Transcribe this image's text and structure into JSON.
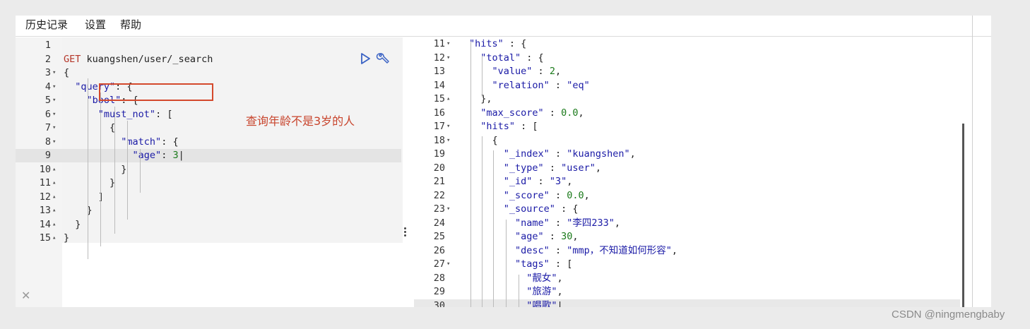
{
  "menu": {
    "history": "历史记录",
    "settings": "设置",
    "help": "帮助"
  },
  "editor": {
    "annotation": "查询年龄不是3岁的人",
    "lines": [
      {
        "n": "1",
        "fold": "",
        "indent": "",
        "html": ""
      },
      {
        "n": "2",
        "fold": "",
        "indent": "",
        "html": "<span class='kw'>GET</span> kuangshen/user/_search"
      },
      {
        "n": "3",
        "fold": "▾",
        "indent": "",
        "html": "{"
      },
      {
        "n": "4",
        "fold": "▾",
        "indent": "  ",
        "html": "<span class='str'>\"query\"</span>: {"
      },
      {
        "n": "5",
        "fold": "▾",
        "indent": "    ",
        "html": "<span class='str'>\"bool\"</span>: {"
      },
      {
        "n": "6",
        "fold": "▾",
        "indent": "      ",
        "html": "<span class='str'>\"must_not\"</span>: ["
      },
      {
        "n": "7",
        "fold": "▾",
        "indent": "        ",
        "html": "{"
      },
      {
        "n": "8",
        "fold": "▾",
        "indent": "          ",
        "html": "<span class='str'>\"match\"</span>: {"
      },
      {
        "n": "9",
        "fold": "",
        "indent": "            ",
        "html": "<span class='str'>\"age\"</span>: <span class='num'>3</span>|"
      },
      {
        "n": "10",
        "fold": "▴",
        "indent": "          ",
        "html": "}"
      },
      {
        "n": "11",
        "fold": "▴",
        "indent": "        ",
        "html": "}"
      },
      {
        "n": "12",
        "fold": "▴",
        "indent": "      ",
        "html": "]"
      },
      {
        "n": "13",
        "fold": "▴",
        "indent": "    ",
        "html": "}"
      },
      {
        "n": "14",
        "fold": "▴",
        "indent": "  ",
        "html": "}"
      },
      {
        "n": "15",
        "fold": "▴",
        "indent": "",
        "html": "}"
      }
    ]
  },
  "result": {
    "lines": [
      {
        "n": "11",
        "fold": "▾",
        "indent": "",
        "html": "<span class='str'>\"hits\"</span> : {"
      },
      {
        "n": "12",
        "fold": "▾",
        "indent": "  ",
        "html": "<span class='str'>\"total\"</span> : {"
      },
      {
        "n": "13",
        "fold": "",
        "indent": "    ",
        "html": "<span class='str'>\"value\"</span> : <span class='num'>2</span>,"
      },
      {
        "n": "14",
        "fold": "",
        "indent": "    ",
        "html": "<span class='str'>\"relation\"</span> : <span class='str'>\"eq\"</span>"
      },
      {
        "n": "15",
        "fold": "▴",
        "indent": "  ",
        "html": "},"
      },
      {
        "n": "16",
        "fold": "",
        "indent": "  ",
        "html": "<span class='str'>\"max_score\"</span> : <span class='num'>0.0</span>,"
      },
      {
        "n": "17",
        "fold": "▾",
        "indent": "  ",
        "html": "<span class='str'>\"hits\"</span> : ["
      },
      {
        "n": "18",
        "fold": "▾",
        "indent": "    ",
        "html": "{"
      },
      {
        "n": "19",
        "fold": "",
        "indent": "      ",
        "html": "<span class='str'>\"_index\"</span> : <span class='str'>\"kuangshen\"</span>,"
      },
      {
        "n": "20",
        "fold": "",
        "indent": "      ",
        "html": "<span class='str'>\"_type\"</span> : <span class='str'>\"user\"</span>,"
      },
      {
        "n": "21",
        "fold": "",
        "indent": "      ",
        "html": "<span class='str'>\"_id\"</span> : <span class='str'>\"3\"</span>,"
      },
      {
        "n": "22",
        "fold": "",
        "indent": "      ",
        "html": "<span class='str'>\"_score\"</span> : <span class='num'>0.0</span>,"
      },
      {
        "n": "23",
        "fold": "▾",
        "indent": "      ",
        "html": "<span class='str'>\"_source\"</span> : {"
      },
      {
        "n": "24",
        "fold": "",
        "indent": "        ",
        "html": "<span class='str'>\"name\"</span> : <span class='str'>\"李四233\"</span>,"
      },
      {
        "n": "25",
        "fold": "",
        "indent": "        ",
        "html": "<span class='str'>\"age\"</span> : <span class='num'>30</span>,"
      },
      {
        "n": "26",
        "fold": "",
        "indent": "        ",
        "html": "<span class='str'>\"desc\"</span> : <span class='str'>\"mmp，不知道如何形容\"</span>,"
      },
      {
        "n": "27",
        "fold": "▾",
        "indent": "        ",
        "html": "<span class='str'>\"tags\"</span> : ["
      },
      {
        "n": "28",
        "fold": "",
        "indent": "          ",
        "html": "<span class='str'>\"靓女\"</span>,"
      },
      {
        "n": "29",
        "fold": "",
        "indent": "          ",
        "html": "<span class='str'>\"旅游\"</span>,"
      },
      {
        "n": "30",
        "fold": "",
        "indent": "          ",
        "html": "<span class='str'>\"唱歌\"</span>|"
      }
    ]
  },
  "watermark": "CSDN @ningmengbaby",
  "icons": {
    "run": "play-triangle-icon",
    "settings": "wrench-icon",
    "close": "close-icon"
  },
  "colors": {
    "keyword": "#b5372a",
    "string": "#1a1aa6",
    "number": "#1a7a1a",
    "annotation": "#d4492c"
  }
}
